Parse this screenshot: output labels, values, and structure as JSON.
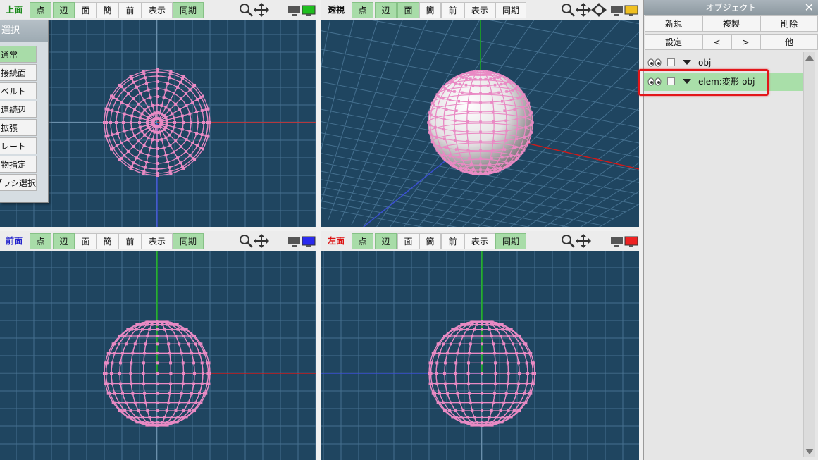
{
  "toolbar_buttons": {
    "vertex": "点",
    "edge": "辺",
    "face": "面",
    "simple": "簡",
    "front": "前",
    "display": "表示",
    "sync": "同期"
  },
  "viewports": {
    "top": {
      "label": "上面",
      "label_color": "#1a8a1a",
      "monitor_color": "#1fbf1f"
    },
    "persp": {
      "label": "透視",
      "label_color": "#111111",
      "monitor_color": "#f0c020"
    },
    "front": {
      "label": "前面",
      "label_color": "#2222cc",
      "monitor_color": "#2a2aee"
    },
    "left": {
      "label": "左面",
      "label_color": "#dd1111",
      "monitor_color": "#ee2222"
    }
  },
  "selection_panel": {
    "title": "選択",
    "items": [
      "通常",
      "接続面",
      "ベルト",
      "連続辺",
      "拡張",
      "レート",
      "物指定",
      "ブラシ選択"
    ]
  },
  "object_panel": {
    "title": "オブジェクト",
    "buttons": {
      "new": "新規",
      "duplicate": "複製",
      "delete": "削除",
      "settings": "設定",
      "prev": "<",
      "next": ">",
      "other": "他"
    },
    "items": [
      {
        "name": "obj",
        "selected": false
      },
      {
        "name": "elem:変形-obj",
        "selected": true
      }
    ]
  },
  "colors": {
    "accent_green": "#a8dca8",
    "canvas_bg": "#1f4560",
    "grid": "#45708f",
    "mesh": "#e98ac4",
    "highlight": "#e3161a"
  }
}
